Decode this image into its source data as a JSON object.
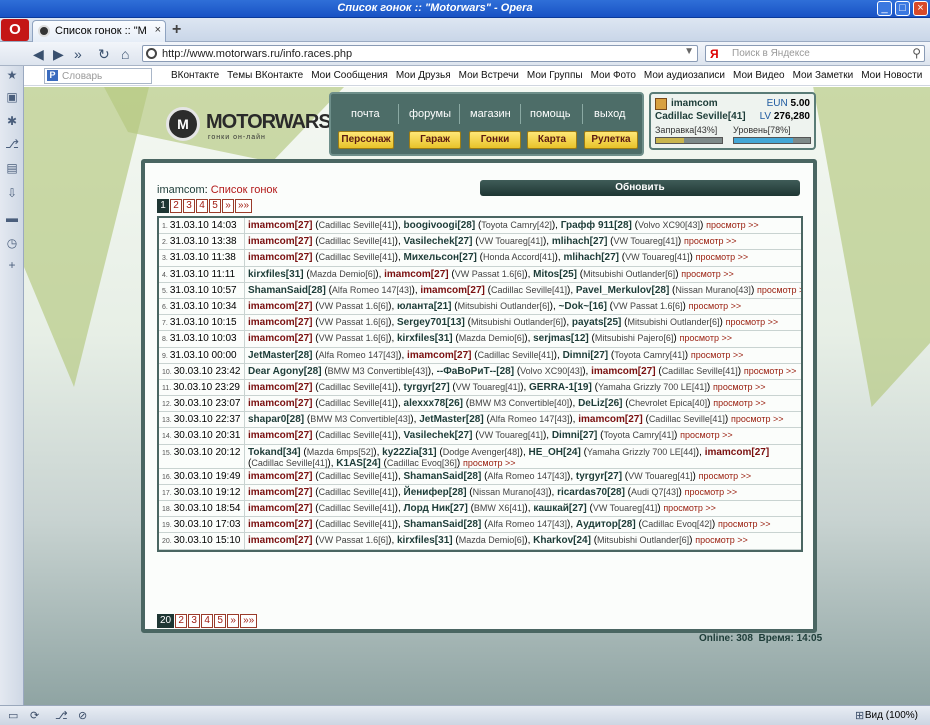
{
  "window": {
    "title": "Список гонок :: \"Motorwars\" - Opera"
  },
  "tab": {
    "label": "Список гонок :: \"Motorw..."
  },
  "address": {
    "url": "http://www.motorwars.ru/info.races.php",
    "search_placeholder": "Поиск в Яндексе",
    "search_engine": "Я"
  },
  "vk": {
    "search_placeholder": "Словарь",
    "links": [
      "ВКонтакте",
      "Темы ВКонтакте",
      "Мои Сообщения",
      "Мои Друзья",
      "Мои Встречи",
      "Мои Группы",
      "Мои Фото",
      "Мои аудиозаписи",
      "Мои Видео",
      "Мои Заметки",
      "Мои Новости"
    ]
  },
  "site": {
    "logo_name": "MOTORWARS.RU",
    "logo_sub": "гонки он-лайн"
  },
  "menu": {
    "top": [
      "почта",
      "форумы",
      "магазин",
      "помощь",
      "выход"
    ],
    "buttons": [
      "Персонаж",
      "Гараж",
      "Гонки",
      "Карта",
      "Рулетка"
    ]
  },
  "user": {
    "name": "imamcom",
    "car": "Cadillac Seville[41]",
    "eun_label": "EUN",
    "eun": "5.00",
    "lv_label": "LV",
    "lv": "276,280",
    "fuel_label": "Заправка[43%]",
    "fuel": 0.43,
    "level_label": "Уровень[78%]",
    "level": 0.78
  },
  "crumb": {
    "user": "imamcom",
    "sep": ": ",
    "title": "Список гонок"
  },
  "refresh_label": "Обновить",
  "pager_top": [
    "1",
    "2",
    "3",
    "4",
    "5",
    "»",
    "»»"
  ],
  "pager_bottom": [
    "20",
    "2",
    "3",
    "4",
    "5",
    "»",
    "»»"
  ],
  "races": [
    {
      "n": "1.",
      "date": "31.03.10 14:03",
      "p": [
        [
          "imamcom[27]",
          "Cadillac Seville[41]"
        ],
        [
          "boogivoogi[28]",
          "Toyota Camry[42]"
        ],
        [
          "Графф 911[28]",
          "Volvo XC90[43]"
        ]
      ]
    },
    {
      "n": "2.",
      "date": "31.03.10 13:38",
      "p": [
        [
          "imamcom[27]",
          "Cadillac Seville[41]"
        ],
        [
          "Vasilechek[27]",
          "VW Touareg[41]"
        ],
        [
          "mlihach[27]",
          "VW Touareg[41]"
        ]
      ]
    },
    {
      "n": "3.",
      "date": "31.03.10 11:38",
      "p": [
        [
          "imamcom[27]",
          "Cadillac Seville[41]"
        ],
        [
          "Михельсон[27]",
          "Honda Accord[41]"
        ],
        [
          "mlihach[27]",
          "VW Touareg[41]"
        ]
      ]
    },
    {
      "n": "4.",
      "date": "31.03.10 11:11",
      "p": [
        [
          "kirxfiles[31]",
          "Mazda Demio[6]"
        ],
        [
          "imamcom[27]",
          "VW Passat 1.6[6]"
        ],
        [
          "Mitos[25]",
          "Mitsubishi Outlander[6]"
        ]
      ]
    },
    {
      "n": "5.",
      "date": "31.03.10 10:57",
      "p": [
        [
          "ShamanSaid[28]",
          "Alfa Romeo 147[43]"
        ],
        [
          "imamcom[27]",
          "Cadillac Seville[41]"
        ],
        [
          "Pavel_Merkulov[28]",
          "Nissan Murano[43]"
        ]
      ]
    },
    {
      "n": "6.",
      "date": "31.03.10 10:34",
      "p": [
        [
          "imamcom[27]",
          "VW Passat 1.6[6]"
        ],
        [
          "юланта[21]",
          "Mitsubishi Outlander[6]"
        ],
        [
          "~Dok~[16]",
          "VW Passat 1.6[6]"
        ]
      ]
    },
    {
      "n": "7.",
      "date": "31.03.10 10:15",
      "p": [
        [
          "imamcom[27]",
          "VW Passat 1.6[6]"
        ],
        [
          "Sergey701[13]",
          "Mitsubishi Outlander[6]"
        ],
        [
          "payats[25]",
          "Mitsubishi Outlander[6]"
        ]
      ]
    },
    {
      "n": "8.",
      "date": "31.03.10 10:03",
      "p": [
        [
          "imamcom[27]",
          "VW Passat 1.6[6]"
        ],
        [
          "kirxfiles[31]",
          "Mazda Demio[6]"
        ],
        [
          "serjmas[12]",
          "Mitsubishi Pajero[6]"
        ]
      ]
    },
    {
      "n": "9.",
      "date": "31.03.10 00:00",
      "p": [
        [
          "JetMaster[28]",
          "Alfa Romeo 147[43]"
        ],
        [
          "imamcom[27]",
          "Cadillac Seville[41]"
        ],
        [
          "Dimni[27]",
          "Toyota Camry[41]"
        ]
      ]
    },
    {
      "n": "10.",
      "date": "30.03.10 23:42",
      "p": [
        [
          "Dear Agony[28]",
          "BMW M3 Convertible[43]"
        ],
        [
          "--ФаВоРиТ--[28]",
          "Volvo XC90[43]"
        ],
        [
          "imamcom[27]",
          "Cadillac Seville[41]"
        ]
      ]
    },
    {
      "n": "11.",
      "date": "30.03.10 23:29",
      "p": [
        [
          "imamcom[27]",
          "Cadillac Seville[41]"
        ],
        [
          "tyrgyr[27]",
          "VW Touareg[41]"
        ],
        [
          "GERRA-1[19]",
          "Yamaha Grizzly 700 LE[41]"
        ]
      ]
    },
    {
      "n": "12.",
      "date": "30.03.10 23:07",
      "p": [
        [
          "imamcom[27]",
          "Cadillac Seville[41]"
        ],
        [
          "alexxx78[26]",
          "BMW M3 Convertible[40]"
        ],
        [
          "DeLiz[26]",
          "Chevrolet Epica[40]"
        ]
      ]
    },
    {
      "n": "13.",
      "date": "30.03.10 22:37",
      "p": [
        [
          "shapar0[28]",
          "BMW M3 Convertible[43]"
        ],
        [
          "JetMaster[28]",
          "Alfa Romeo 147[43]"
        ],
        [
          "imamcom[27]",
          "Cadillac Seville[41]"
        ]
      ]
    },
    {
      "n": "14.",
      "date": "30.03.10 20:31",
      "p": [
        [
          "imamcom[27]",
          "Cadillac Seville[41]"
        ],
        [
          "Vasilechek[27]",
          "VW Touareg[41]"
        ],
        [
          "Dimni[27]",
          "Toyota Camry[41]"
        ]
      ]
    },
    {
      "n": "15.",
      "date": "30.03.10 20:12",
      "tall": true,
      "p": [
        [
          "Tokand[34]",
          "Mazda 6mps[52]"
        ],
        [
          "ky22Zia[31]",
          "Dodge Avenger[48]"
        ],
        [
          "HE_OH[24]",
          "Yamaha Grizzly 700 LE[44]"
        ],
        [
          "imamcom[27]",
          "Cadillac Seville[41]"
        ],
        [
          "K1AS[24]",
          "Cadillac Evoq[36]"
        ]
      ]
    },
    {
      "n": "16.",
      "date": "30.03.10 19:49",
      "p": [
        [
          "imamcom[27]",
          "Cadillac Seville[41]"
        ],
        [
          "ShamanSaid[28]",
          "Alfa Romeo 147[43]"
        ],
        [
          "tyrgyr[27]",
          "VW Touareg[41]"
        ]
      ]
    },
    {
      "n": "17.",
      "date": "30.03.10 19:12",
      "p": [
        [
          "imamcom[27]",
          "Cadillac Seville[41]"
        ],
        [
          "Йенифер[28]",
          "Nissan Murano[43]"
        ],
        [
          "ricardas70[28]",
          "Audi Q7[43]"
        ]
      ]
    },
    {
      "n": "18.",
      "date": "30.03.10 18:54",
      "p": [
        [
          "imamcom[27]",
          "Cadillac Seville[41]"
        ],
        [
          "Лорд Ник[27]",
          "BMW X6[41]"
        ],
        [
          "кашкай[27]",
          "VW Touareg[41]"
        ]
      ]
    },
    {
      "n": "19.",
      "date": "30.03.10 17:03",
      "p": [
        [
          "imamcom[27]",
          "Cadillac Seville[41]"
        ],
        [
          "ShamanSaid[28]",
          "Alfa Romeo 147[43]"
        ],
        [
          "Аудитор[28]",
          "Cadillac Evoq[42]"
        ]
      ]
    },
    {
      "n": "20.",
      "date": "30.03.10 15:10",
      "p": [
        [
          "imamcom[27]",
          "VW Passat 1.6[6]"
        ],
        [
          "kirxfiles[31]",
          "Mazda Demio[6]"
        ],
        [
          "Kharkov[24]",
          "Mitsubishi Outlander[6]"
        ]
      ]
    }
  ],
  "view_label": "просмотр >>",
  "footer": {
    "online": "Online: 308",
    "time": "Время: 14:05"
  },
  "status": {
    "zoom": "Вид (100%)"
  },
  "colors": {
    "brand": "#4a6662",
    "player": "#7a1010",
    "link": "#9a2010"
  }
}
